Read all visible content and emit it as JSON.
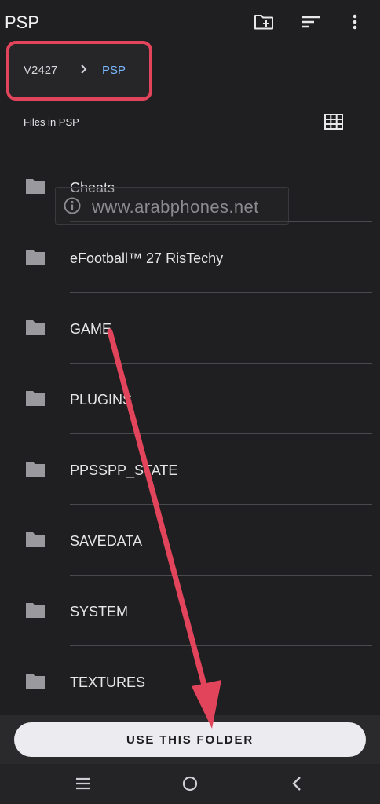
{
  "header": {
    "title": "PSP"
  },
  "breadcrumb": {
    "root": "V2427",
    "current": "PSP"
  },
  "section": {
    "files_label": "Files in PSP"
  },
  "folders": [
    {
      "name": "Cheats"
    },
    {
      "name": "eFootball™ 27 RisTechy"
    },
    {
      "name": "GAME"
    },
    {
      "name": "PLUGINS"
    },
    {
      "name": "PPSSPP_STATE"
    },
    {
      "name": "SAVEDATA"
    },
    {
      "name": "SYSTEM"
    },
    {
      "name": "TEXTURES"
    }
  ],
  "watermark": {
    "text": "www.arabphones.net"
  },
  "action": {
    "use_folder_label": "USE THIS FOLDER"
  },
  "icons": {
    "new_folder": "create-folder-icon",
    "sort": "sort-icon",
    "more": "more-vert-icon",
    "grid": "grid-view-icon",
    "folder": "folder-icon",
    "info": "info-icon",
    "nav_recents": "recents-icon",
    "nav_home": "home-icon",
    "nav_back": "back-icon"
  },
  "colors": {
    "background": "#1f1f21",
    "accent": "#7ab7ff",
    "annotation": "#e2455b"
  }
}
